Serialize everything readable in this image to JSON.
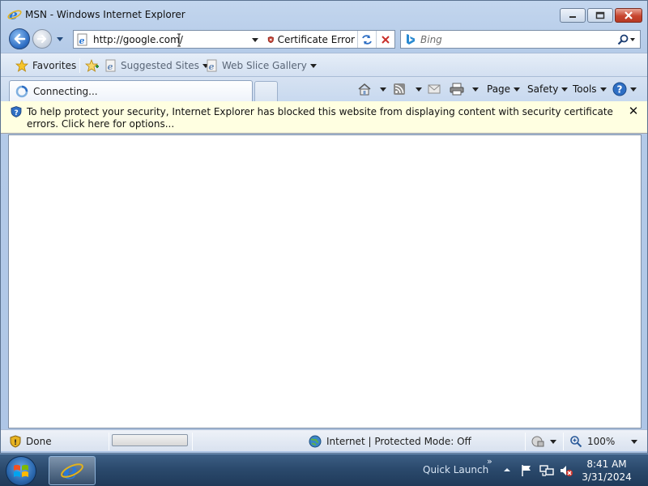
{
  "window": {
    "title": "MSN - Windows Internet Explorer"
  },
  "address_bar": {
    "url": "http://google.com/",
    "certificate_label": "Certificate Error"
  },
  "search": {
    "placeholder": "Bing"
  },
  "favorites_bar": {
    "favorites_label": "Favorites",
    "links": [
      {
        "label": "Suggested Sites"
      },
      {
        "label": "Web Slice Gallery"
      }
    ]
  },
  "tab": {
    "label": "Connecting..."
  },
  "command_bar": {
    "page_label": "Page",
    "safety_label": "Safety",
    "tools_label": "Tools"
  },
  "info_bar": {
    "text": "To help protect your security, Internet Explorer has blocked this website from displaying content with security certificate errors. Click here for options..."
  },
  "status_bar": {
    "status": "Done",
    "zone": "Internet | Protected Mode: Off",
    "zoom": "100%"
  },
  "taskbar": {
    "quick_launch": "Quick Launch",
    "overflow": "»",
    "time": "8:41 AM",
    "date": "3/31/2024"
  },
  "colors": {
    "accent_blue": "#2f6fc4",
    "info_bar_bg": "#ffffe1",
    "cert_error_red": "#c0392b",
    "taskbar_bg": "#2b4a6d"
  },
  "icons": {
    "title": "ie-icon",
    "back": "back-arrow-icon",
    "forward": "forward-arrow-icon",
    "certificate": "shield-error-icon",
    "refresh": "refresh-icon",
    "stop": "stop-x-icon",
    "search": "magnifier-icon",
    "favorites": "star-icon",
    "home": "home-icon",
    "feeds": "rss-icon",
    "mail": "mail-icon",
    "print": "printer-icon",
    "help": "help-icon",
    "info": "shield-info-icon"
  }
}
